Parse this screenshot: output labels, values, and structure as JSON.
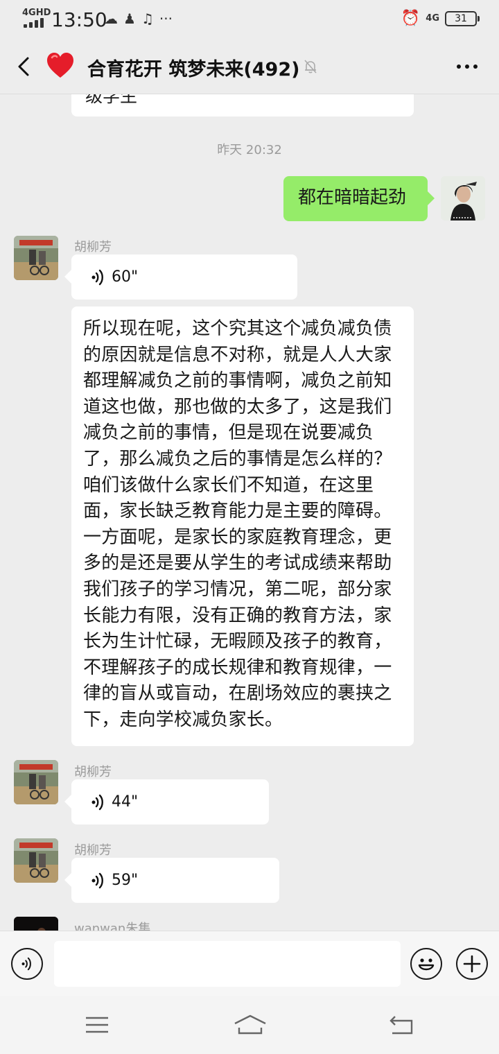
{
  "status_bar": {
    "network": "4GHD",
    "time": "13:50",
    "network_right": "4G",
    "battery": "31"
  },
  "header": {
    "title": "合育花开 筑梦未来(492)"
  },
  "chat": {
    "partial_message": "级学生",
    "timestamp": "昨天 20:32",
    "my_message": "都在暗暗起劲",
    "msg1_sender": "胡柳芳",
    "msg1_voice": "60\"",
    "msg1_text": "所以现在呢，这个究其这个减负减负债的原因就是信息不对称，就是人人大家都理解减负之前的事情啊，减负之前知道这也做，那也做的太多了，这是我们减负之前的事情，但是现在说要减负了，那么减负之后的事情是怎么样的？咱们该做什么家长们不知道，在这里面，家长缺乏教育能力是主要的障碍。一方面呢，是家长的家庭教育理念，更多的是还是要从学生的考试成绩来帮助我们孩子的学习情况，第二呢，部分家长能力有限，没有正确的教育方法，家长为生计忙碌，无暇顾及孩子的教育，不理解孩子的成长规律和教育规律，一律的盲从或盲动，在剧场效应的裹挟之下，走向学校减负家长。",
    "msg2_sender": "胡柳芳",
    "msg2_voice": "44\"",
    "msg3_sender": "胡柳芳",
    "msg3_voice": "59\"",
    "msg4_sender": "wanwan朱集"
  },
  "colors": {
    "background": "#ededed",
    "my_bubble": "#95ec69",
    "other_bubble": "#ffffff"
  },
  "icons": [
    "back-arrow-icon",
    "heart-icon",
    "mute-bell-icon",
    "more-icon",
    "voice-wave-icon",
    "voice-input-icon",
    "emoji-icon",
    "plus-icon",
    "menu-icon",
    "home-icon",
    "return-icon"
  ]
}
